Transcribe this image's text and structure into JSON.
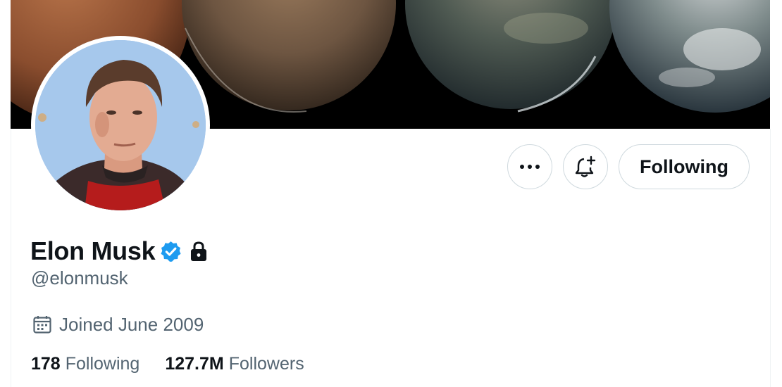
{
  "profile": {
    "display_name": "Elon Musk",
    "handle": "@elonmusk",
    "joined": "Joined June 2009",
    "verified": true,
    "protected_icon": "lock-icon"
  },
  "actions": {
    "more_icon": "more-icon",
    "notify_icon": "bell-plus-icon",
    "following_label": "Following"
  },
  "stats": {
    "following_count": "178",
    "following_label": "Following",
    "followers_count": "127.7M",
    "followers_label": "Followers"
  },
  "colors": {
    "verified_blue": "#1d9bf0",
    "secondary_text": "#536471",
    "primary_text": "#0f1419",
    "border": "#cfd9de"
  }
}
